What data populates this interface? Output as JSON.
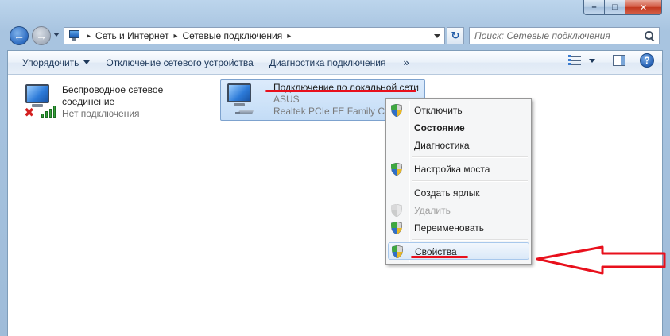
{
  "window": {
    "minimize_glyph": "–",
    "maximize_glyph": "□",
    "close_glyph": "✕"
  },
  "address_bar": {
    "breadcrumbs": [
      "Сеть и Интернет",
      "Сетевые подключения"
    ],
    "separator": "▸"
  },
  "search": {
    "placeholder": "Поиск: Сетевые подключения"
  },
  "toolbar": {
    "organize_label": "Упорядочить",
    "disable_device_label": "Отключение сетевого устройства",
    "diagnose_label": "Диагностика подключения",
    "more_label": "»"
  },
  "connections": [
    {
      "title_line1": "Беспроводное сетевое",
      "title_line2": "соединение",
      "status": "Нет подключения",
      "icon": "wireless-network-icon"
    },
    {
      "title": "Подключение по локальной сети",
      "network": "ASUS",
      "adapter": "Realtek PCIe FE Family Contr",
      "icon": "wired-network-icon"
    }
  ],
  "context_menu": {
    "items": [
      {
        "label": "Отключить",
        "shield": true,
        "bold": false,
        "disabled": false
      },
      {
        "label": "Состояние",
        "shield": false,
        "bold": true,
        "disabled": false
      },
      {
        "label": "Диагностика",
        "shield": false,
        "bold": false,
        "disabled": false
      },
      {
        "label": "Настройка моста",
        "shield": true,
        "bold": false,
        "disabled": false
      },
      {
        "label": "Создать ярлык",
        "shield": false,
        "bold": false,
        "disabled": false
      },
      {
        "label": "Удалить",
        "shield": true,
        "bold": false,
        "disabled": true
      },
      {
        "label": "Переименовать",
        "shield": true,
        "bold": false,
        "disabled": false
      },
      {
        "label": "Свойства",
        "shield": true,
        "bold": false,
        "disabled": false,
        "highlighted": true
      }
    ]
  },
  "colors": {
    "annotation_red": "#e8101c",
    "selection_blue": "#c3dcf6",
    "command_text": "#1e395b"
  }
}
